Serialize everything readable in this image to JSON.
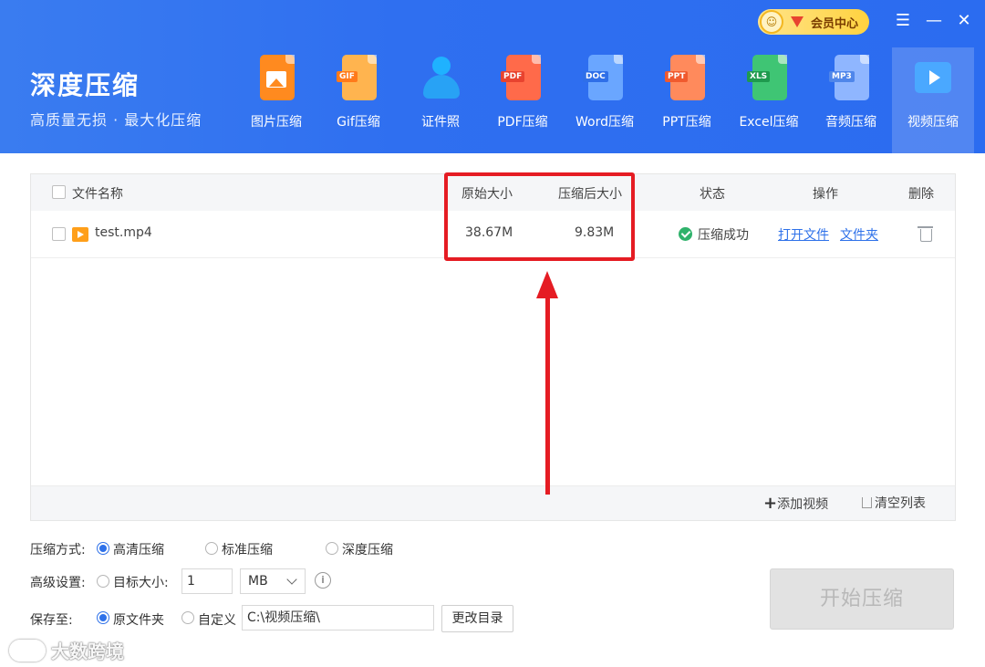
{
  "header": {
    "title": "深度压缩",
    "subtitle": "高质量无损 · 最大化压缩",
    "vip_label": "会员中心"
  },
  "tools": [
    {
      "label": "图片压缩",
      "icon": "image-icon",
      "color": "#ff8a1f"
    },
    {
      "label": "Gif压缩",
      "icon": "gif-icon",
      "color": "#ff9b2e",
      "tag": "GIF"
    },
    {
      "label": "证件照",
      "icon": "id-photo-icon",
      "color": "#1fb2ff"
    },
    {
      "label": "PDF压缩",
      "icon": "pdf-icon",
      "color": "#ff5a3c",
      "tag": "PDF"
    },
    {
      "label": "Word压缩",
      "icon": "word-icon",
      "color": "#3d8bff",
      "tag": "DOC"
    },
    {
      "label": "PPT压缩",
      "icon": "ppt-icon",
      "color": "#ff6b3d",
      "tag": "PPT"
    },
    {
      "label": "Excel压缩",
      "icon": "excel-icon",
      "color": "#25b45c",
      "tag": "XLS"
    },
    {
      "label": "音频压缩",
      "icon": "audio-icon",
      "color": "#5b9bff",
      "tag": "MP3"
    },
    {
      "label": "视频压缩",
      "icon": "video-icon",
      "color": "#4aa8ff"
    }
  ],
  "table": {
    "headers": {
      "name": "文件名称",
      "original": "原始大小",
      "compressed": "压缩后大小",
      "status": "状态",
      "action": "操作",
      "delete": "删除"
    },
    "rows": [
      {
        "name": "test.mp4",
        "original": "38.67M",
        "compressed": "9.83M",
        "status": "压缩成功",
        "open_file": "打开文件",
        "folder": "文件夹"
      }
    ],
    "add_video": "添加视频",
    "clear_list": "清空列表"
  },
  "settings": {
    "mode_label": "压缩方式:",
    "modes": [
      "高清压缩",
      "标准压缩",
      "深度压缩"
    ],
    "selected_mode": "高清压缩",
    "advanced_label": "高级设置:",
    "target_size_label": "目标大小:",
    "target_size_value": "1",
    "unit": "MB",
    "save_label": "保存至:",
    "save_options": [
      "原文件夹",
      "自定义"
    ],
    "selected_save": "原文件夹",
    "path": "C:\\视频压缩\\",
    "change_dir": "更改目录",
    "start": "开始压缩"
  },
  "watermark": "大数跨境",
  "colors": {
    "header_blue": "#2f6ff0",
    "link_blue": "#2e71e9",
    "highlight_red": "#e51c23",
    "success_green": "#2fb26b"
  }
}
